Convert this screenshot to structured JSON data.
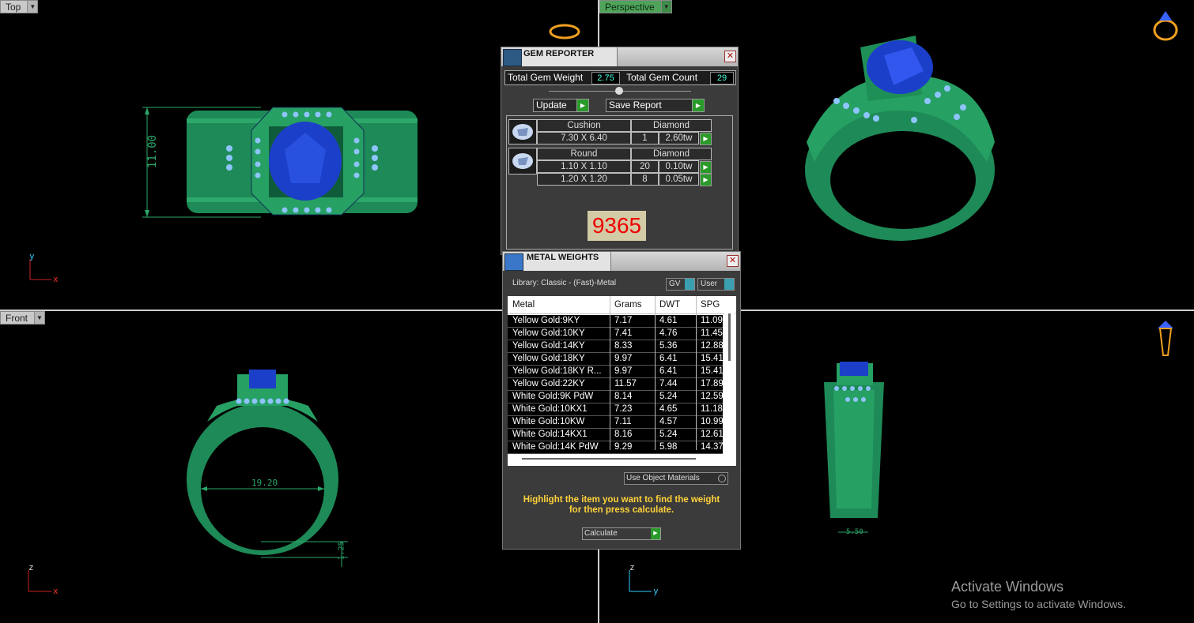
{
  "viewports": {
    "top": {
      "label": "Top",
      "dimension": "11.00",
      "axes": {
        "v": "y",
        "h": "x"
      }
    },
    "perspective": {
      "label": "Perspective"
    },
    "front": {
      "label": "Front",
      "dimension_width": "19.20",
      "dimension_height": "1.25",
      "axes": {
        "v": "z",
        "h": "x"
      }
    },
    "right": {
      "dimension": "5.50",
      "axes": {
        "v": "z",
        "h": "y"
      }
    }
  },
  "gem_reporter": {
    "title": "GEM REPORTER",
    "total_weight_label": "Total Gem Weight",
    "total_weight_value": "2.75",
    "total_count_label": "Total Gem Count",
    "total_count_value": "29",
    "update_label": "Update",
    "save_report_label": "Save Report",
    "groups": [
      {
        "shape": "Cushion",
        "material": "Diamond",
        "rows": [
          {
            "size": "7.30 X 6.40",
            "count": "1",
            "weight": "2.60tw"
          }
        ]
      },
      {
        "shape": "Round",
        "material": "Diamond",
        "rows": [
          {
            "size": "1.10 X 1.10",
            "count": "20",
            "weight": "0.10tw"
          },
          {
            "size": "1.20 X 1.20",
            "count": "8",
            "weight": "0.05tw"
          }
        ]
      }
    ],
    "code": "9365"
  },
  "metal_weights": {
    "title": "METAL WEIGHTS",
    "library": "Library: Classic - (Fast)-Metal",
    "gv_label": "GV",
    "user_label": "User",
    "columns": [
      "Metal",
      "Grams",
      "DWT",
      "SPG"
    ],
    "rows": [
      [
        "Yellow Gold:9KY",
        "7.17",
        "4.61",
        "11.09"
      ],
      [
        "Yellow Gold:10KY",
        "7.41",
        "4.76",
        "11.45"
      ],
      [
        "Yellow Gold:14KY",
        "8.33",
        "5.36",
        "12.88"
      ],
      [
        "Yellow Gold:18KY",
        "9.97",
        "6.41",
        "15.41"
      ],
      [
        "Yellow Gold:18KY R...",
        "9.97",
        "6.41",
        "15.41"
      ],
      [
        "Yellow Gold:22KY",
        "11.57",
        "7.44",
        "17.89"
      ],
      [
        "White Gold:9K PdW",
        "8.14",
        "5.24",
        "12.59"
      ],
      [
        "White Gold:10KX1",
        "7.23",
        "4.65",
        "11.18"
      ],
      [
        "White Gold:10KW",
        "7.11",
        "4.57",
        "10.99"
      ],
      [
        "White Gold:14KX1",
        "8.16",
        "5.24",
        "12.61"
      ],
      [
        "White Gold:14K PdW",
        "9.29",
        "5.98",
        "14.37"
      ]
    ],
    "use_object_materials": "Use Object Materials",
    "hint_line1": "Highlight the item you want to find the weight",
    "hint_line2": "for then press calculate.",
    "calculate_label": "Calculate"
  },
  "watermark": {
    "line1": "Activate Windows",
    "line2": "Go to Settings to activate Windows."
  },
  "colors": {
    "metal": "#1f8a55",
    "gem": "#1c3fc9",
    "accent_green": "#2a9a2a",
    "code_red": "#e00000"
  }
}
